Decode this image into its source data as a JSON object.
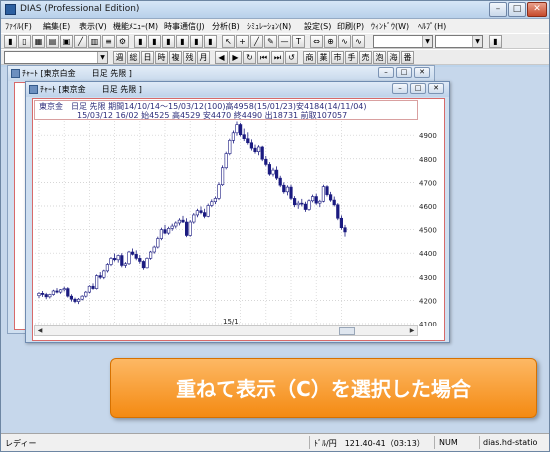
{
  "app": {
    "title": "DIAS (Professional Edition)",
    "controls": {
      "minimize": "–",
      "maximize": "□",
      "close": "✕"
    }
  },
  "menu": [
    "ﾌｧｲﾙ(F)",
    "編集(E)",
    "表示(V)",
    "機能ﾒﾆｭｰ(M)",
    "時事通信(J)",
    "分析(B)",
    "ｼﾐｭﾚｰｼｮﾝ(N)",
    "設定(S)",
    "印刷(P)",
    "ｳｨﾝﾄﾞｳ(W)",
    "ﾍﾙﾌﾟ(H)"
  ],
  "toolbar2_labels": [
    "週",
    "総",
    "日",
    "時",
    "複",
    "残",
    "月",
    "商",
    "業",
    "市",
    "手",
    "売",
    "泡",
    "海",
    "番"
  ],
  "window_back": {
    "title": "ﾁｬｰﾄ [東京白金　　日足 先限 ]"
  },
  "window_front": {
    "title": "ﾁｬｰﾄ [東京金　　日足 先限 ]",
    "info_line1": "東京金　日足 先限 期間14/10/14～15/03/12(100)高4958(15/01/23)安4184(14/11/04)",
    "info_line2": "15/03/12 16/02 始4525 高4529 安4470 終4490 出18731 前取107057"
  },
  "banner": {
    "text": "重ねて表示（C）を選択した場合"
  },
  "status": {
    "ready": "レディー",
    "rate": "ﾄﾞﾙ/円　121.40-41（03:13）",
    "num": "NUM",
    "host": "dias.hd-statio"
  },
  "chart_data": {
    "type": "candlestick",
    "title": "",
    "xlabel": "",
    "ylabel": "",
    "x_tick_labels": [
      "15/1"
    ],
    "y_tick_labels": [
      "4900",
      "4800",
      "4700",
      "4600",
      "4500",
      "4400",
      "4300",
      "4200",
      "4100"
    ],
    "ylim": [
      4100,
      4960
    ],
    "grid": true,
    "up_color": "#ffffff",
    "down_color": "#1a1a80",
    "bar_spacing_px": 3.6,
    "candles": [
      [
        4220,
        4235,
        4210,
        4230
      ],
      [
        4230,
        4240,
        4215,
        4225
      ],
      [
        4225,
        4232,
        4205,
        4215
      ],
      [
        4215,
        4228,
        4208,
        4225
      ],
      [
        4225,
        4245,
        4220,
        4240
      ],
      [
        4240,
        4252,
        4230,
        4235
      ],
      [
        4235,
        4248,
        4228,
        4245
      ],
      [
        4245,
        4258,
        4238,
        4250
      ],
      [
        4250,
        4256,
        4212,
        4218
      ],
      [
        4218,
        4226,
        4195,
        4205
      ],
      [
        4205,
        4212,
        4188,
        4195
      ],
      [
        4195,
        4210,
        4184,
        4205
      ],
      [
        4205,
        4222,
        4200,
        4218
      ],
      [
        4218,
        4240,
        4212,
        4235
      ],
      [
        4235,
        4264,
        4230,
        4260
      ],
      [
        4260,
        4272,
        4245,
        4250
      ],
      [
        4250,
        4310,
        4246,
        4305
      ],
      [
        4305,
        4320,
        4290,
        4298
      ],
      [
        4298,
        4330,
        4290,
        4325
      ],
      [
        4325,
        4358,
        4318,
        4352
      ],
      [
        4352,
        4384,
        4345,
        4378
      ],
      [
        4378,
        4398,
        4365,
        4372
      ],
      [
        4372,
        4394,
        4360,
        4390
      ],
      [
        4390,
        4400,
        4340,
        4348
      ],
      [
        4348,
        4362,
        4338,
        4355
      ],
      [
        4355,
        4410,
        4350,
        4405
      ],
      [
        4405,
        4420,
        4390,
        4395
      ],
      [
        4395,
        4412,
        4370,
        4378
      ],
      [
        4378,
        4392,
        4355,
        4365
      ],
      [
        4365,
        4370,
        4330,
        4338
      ],
      [
        4338,
        4382,
        4335,
        4378
      ],
      [
        4378,
        4410,
        4372,
        4405
      ],
      [
        4405,
        4432,
        4398,
        4426
      ],
      [
        4426,
        4470,
        4420,
        4462
      ],
      [
        4462,
        4508,
        4455,
        4500
      ],
      [
        4500,
        4520,
        4480,
        4485
      ],
      [
        4485,
        4512,
        4478,
        4505
      ],
      [
        4505,
        4525,
        4495,
        4515
      ],
      [
        4515,
        4535,
        4505,
        4528
      ],
      [
        4528,
        4548,
        4518,
        4540
      ],
      [
        4540,
        4558,
        4528,
        4532
      ],
      [
        4532,
        4548,
        4468,
        4475
      ],
      [
        4475,
        4540,
        4470,
        4532
      ],
      [
        4532,
        4570,
        4525,
        4562
      ],
      [
        4562,
        4588,
        4552,
        4580
      ],
      [
        4580,
        4598,
        4565,
        4572
      ],
      [
        4572,
        4588,
        4548,
        4556
      ],
      [
        4556,
        4610,
        4552,
        4602
      ],
      [
        4602,
        4628,
        4595,
        4618
      ],
      [
        4618,
        4640,
        4608,
        4632
      ],
      [
        4632,
        4700,
        4625,
        4690
      ],
      [
        4690,
        4772,
        4685,
        4762
      ],
      [
        4762,
        4830,
        4755,
        4822
      ],
      [
        4822,
        4885,
        4815,
        4878
      ],
      [
        4878,
        4920,
        4865,
        4910
      ],
      [
        4910,
        4958,
        4898,
        4945
      ],
      [
        4945,
        4952,
        4895,
        4902
      ],
      [
        4902,
        4928,
        4875,
        4885
      ],
      [
        4885,
        4912,
        4860,
        4868
      ],
      [
        4868,
        4882,
        4835,
        4845
      ],
      [
        4845,
        4860,
        4822,
        4830
      ],
      [
        4830,
        4858,
        4815,
        4850
      ],
      [
        4850,
        4855,
        4790,
        4798
      ],
      [
        4798,
        4812,
        4768,
        4776
      ],
      [
        4776,
        4786,
        4728,
        4735
      ],
      [
        4735,
        4762,
        4725,
        4752
      ],
      [
        4752,
        4768,
        4710,
        4718
      ],
      [
        4718,
        4728,
        4680,
        4688
      ],
      [
        4688,
        4700,
        4652,
        4660
      ],
      [
        4660,
        4688,
        4645,
        4680
      ],
      [
        4680,
        4690,
        4625,
        4632
      ],
      [
        4632,
        4642,
        4595,
        4605
      ],
      [
        4605,
        4622,
        4588,
        4612
      ],
      [
        4612,
        4630,
        4598,
        4608
      ],
      [
        4608,
        4618,
        4575,
        4585
      ],
      [
        4585,
        4628,
        4580,
        4622
      ],
      [
        4622,
        4648,
        4615,
        4640
      ],
      [
        4640,
        4652,
        4605,
        4612
      ],
      [
        4612,
        4626,
        4595,
        4620
      ],
      [
        4620,
        4690,
        4615,
        4682
      ],
      [
        4682,
        4688,
        4640,
        4648
      ],
      [
        4648,
        4660,
        4618,
        4625
      ],
      [
        4625,
        4640,
        4598,
        4605
      ],
      [
        4605,
        4612,
        4540,
        4548
      ],
      [
        4548,
        4560,
        4500,
        4508
      ],
      [
        4508,
        4520,
        4470,
        4490
      ]
    ]
  }
}
